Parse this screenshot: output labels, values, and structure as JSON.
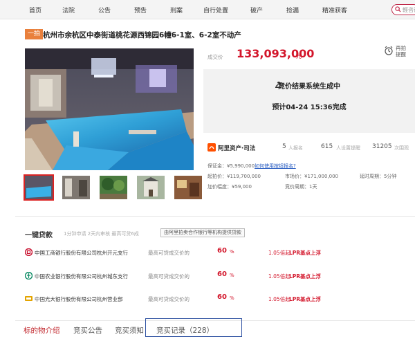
{
  "nav": {
    "items": [
      "首页",
      "法院",
      "公告",
      "预告",
      "刑案",
      "自行处置",
      "破产",
      "捡漏",
      "精准获客"
    ],
    "search_placeholder": "輕咨询"
  },
  "lot": {
    "badge": "一拍",
    "title": "杭州市余杭区中泰街道桃花源西锦园6幢6-1室、6-2室不动产"
  },
  "price": {
    "label": "成交价",
    "value": "133,093,000",
    "unit": "元",
    "remind_label": "再拍提醒"
  },
  "result": {
    "title": "竞价结果系统生成中",
    "time": "预计04-24 15:36完成"
  },
  "stats": {
    "platform": "阿里资产·司法",
    "registrants_num": "5",
    "registrants_label": "人报名",
    "reminders_num": "615",
    "reminders_label": "人设置提醒",
    "views_num": "31205",
    "views_label": "次围观"
  },
  "info": {
    "deposit": "保证金：¥5,990,000",
    "deposit_link": "如何使用按钮报名?",
    "start_price": "起拍价：¥119,700,000",
    "market_price": "市场价：¥171,000,000",
    "delay_label": "延时周期：5分钟",
    "increment": "加价幅度：¥59,000",
    "period": "竞价周期：1天"
  },
  "loan": {
    "title": "一键贷款",
    "subtitle": "1分钟申请  2天内审核  最高可贷6成",
    "button": "由阿里拍卖合作银行等机构提供贷款",
    "rows": [
      {
        "bank": "中国工商银行股份有限公司杭州开元支行",
        "desc": "最高可贷成交价的",
        "pct": "60",
        "pct_suffix": "%",
        "rate": "1.05倍起",
        "lpr": "LPR基点上浮",
        "color": "#c8102e"
      },
      {
        "bank": "中国农业银行股份有限公司杭州城东支行",
        "desc": "最高可贷成交价的",
        "pct": "60",
        "pct_suffix": "%",
        "rate": "1.05倍起",
        "lpr": "LPR基点上浮",
        "color": "#0a8a63"
      },
      {
        "bank": "中国光大银行股份有限公司杭州营业部",
        "desc": "最高可贷成交价的",
        "pct": "60",
        "pct_suffix": "%",
        "rate": "1.05倍起",
        "lpr": "LPR基点上浮",
        "color": "#e4a400"
      }
    ]
  },
  "tabs": [
    "标的物介绍",
    "竞买公告",
    "竞买须知",
    "竞买记录（228）"
  ]
}
